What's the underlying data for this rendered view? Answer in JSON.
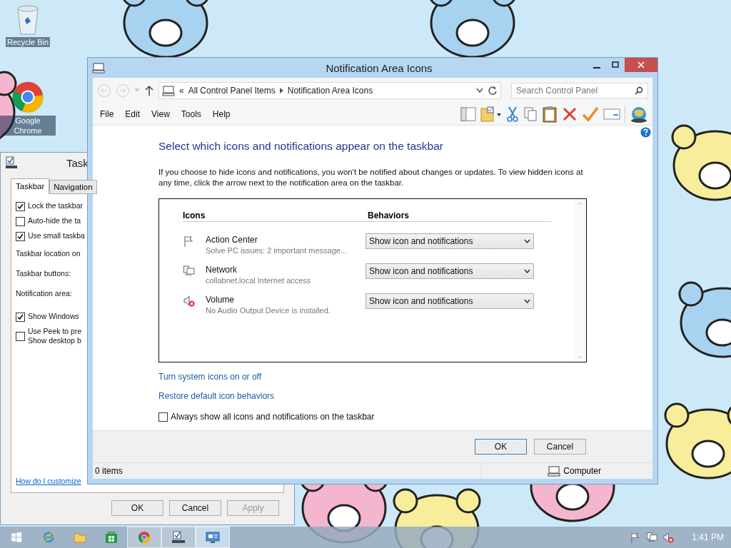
{
  "desktop_icons": [
    {
      "kind": "bin",
      "label": "Recycle Bin"
    },
    {
      "kind": "chrome",
      "label": "Google Chrome"
    }
  ],
  "back_window": {
    "title": "Task",
    "tabs": [
      {
        "label": "Taskbar",
        "selected": true
      },
      {
        "label": "Navigation",
        "selected": false
      }
    ],
    "options": [
      {
        "kind": "checkbox",
        "lines": [
          "Lock the taskbar"
        ],
        "checked": true
      },
      {
        "kind": "checkbox",
        "lines": [
          "Auto-hide the ta"
        ],
        "checked": false
      },
      {
        "kind": "checkbox",
        "lines": [
          "Use small taskba"
        ],
        "checked": true
      },
      {
        "kind": "label",
        "lines": [
          "Taskbar location on"
        ]
      },
      {
        "kind": "label",
        "lines": [
          "Taskbar buttons:"
        ]
      },
      {
        "kind": "label",
        "lines": [
          "Notification area:"
        ]
      },
      {
        "kind": "checkbox",
        "lines": [
          "Show Windows"
        ],
        "checked": true
      },
      {
        "kind": "checkbox",
        "lines": [
          "Use Peek to pre",
          "Show desktop b"
        ],
        "checked": false
      }
    ],
    "help_link": "How do I customize",
    "buttons": [
      {
        "label": "OK",
        "disabled": false
      },
      {
        "label": "Cancel",
        "disabled": false
      },
      {
        "label": "Apply",
        "disabled": true
      }
    ]
  },
  "window": {
    "title": "Notification Area Icons",
    "address": {
      "prefix": "«",
      "crumbs": [
        "All Control Panel Items",
        "Notification Area Icons"
      ]
    },
    "search": {
      "placeholder": "Search Control Panel"
    },
    "menu": [
      "File",
      "Edit",
      "View",
      "Tools",
      "Help"
    ],
    "heading": "Select which icons and notifications appear on the taskbar",
    "description": "If you choose to hide icons and notifications, you won't be notified about changes or updates. To view hidden icons at any time, click the arrow next to the notification area on the taskbar.",
    "columns": [
      "Icons",
      "Behaviors"
    ],
    "rows": [
      {
        "kind": "flag",
        "name": "Action Center",
        "detail": "Solve PC issues: 2 important message...",
        "behavior": "Show icon and notifications"
      },
      {
        "kind": "network",
        "name": "Network",
        "detail": "collabnet.local Internet access",
        "behavior": "Show icon and notifications"
      },
      {
        "kind": "volume",
        "name": "Volume",
        "detail": "No Audio Output Device is installed.",
        "behavior": "Show icon and notifications"
      }
    ],
    "links": [
      "Turn system icons on or off",
      "Restore default icon behaviors"
    ],
    "always_show": {
      "label": "Always show all icons and notifications on the taskbar",
      "checked": false
    },
    "buttons": [
      {
        "label": "OK",
        "default": true
      },
      {
        "label": "Cancel",
        "default": false
      }
    ],
    "status": {
      "items": "0 items",
      "zone": "Computer"
    }
  },
  "taskbar": {
    "apps": [
      {
        "kind": "ie",
        "running": false,
        "active": false
      },
      {
        "kind": "folder",
        "running": false,
        "active": false
      },
      {
        "kind": "store",
        "running": false,
        "active": false
      },
      {
        "kind": "chrome",
        "running": true,
        "active": false
      },
      {
        "kind": "checklist",
        "running": true,
        "active": false
      },
      {
        "kind": "panel",
        "running": true,
        "active": true
      }
    ],
    "tray": [
      {
        "kind": "flag"
      },
      {
        "kind": "network"
      },
      {
        "kind": "volume"
      }
    ],
    "clock": "1:41 PM"
  }
}
